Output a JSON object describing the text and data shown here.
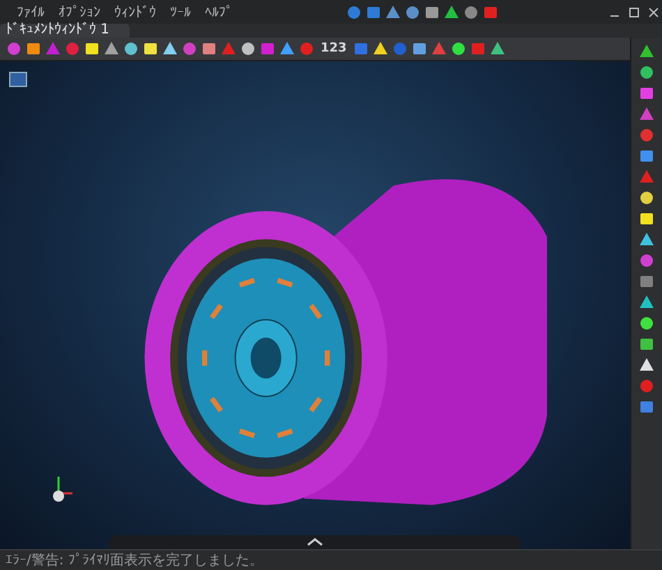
{
  "menu": [
    "ﾌｧｲﾙ",
    "ｵﾌﾟｼｮﾝ",
    "ｳｨﾝﾄﾞｳ",
    "ﾂｰﾙ",
    "ﾍﾙﾌﾟ"
  ],
  "tabs": [
    {
      "label": "ﾄﾞｷｭﾒﾝﾄｳｨﾝﾄﾞｳ 1",
      "selected": true
    }
  ],
  "toolbar_counter": "123",
  "status_bar": "ｴﾗｰ/警告: ﾌﾟﾗｲﾏﾘ面表示を完了しました。"
}
